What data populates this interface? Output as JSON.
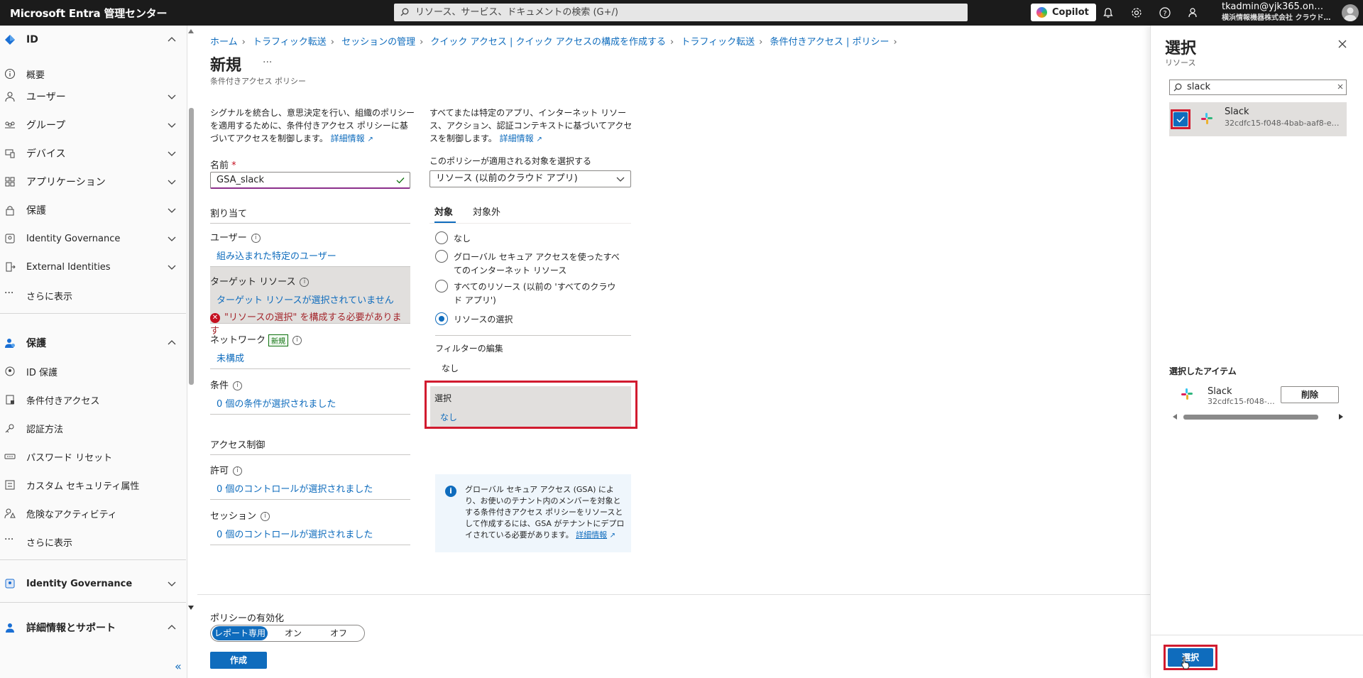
{
  "topbar": {
    "brand": "Microsoft Entra 管理センター",
    "search_placeholder": "リソース、サービス、ドキュメントの検索 (G+/)",
    "copilot": "Copilot",
    "user_email": "tkadmin@yjk365.on…",
    "user_org": "横浜情報機器株式会社 クラウド…"
  },
  "leftnav": {
    "items": [
      {
        "label": "ID"
      },
      {
        "label": "概要"
      },
      {
        "label": "ユーザー"
      },
      {
        "label": "グループ"
      },
      {
        "label": "デバイス"
      },
      {
        "label": "アプリケーション"
      },
      {
        "label": "保護"
      },
      {
        "label": "Identity Governance"
      },
      {
        "label": "External Identities"
      },
      {
        "label": "さらに表示"
      },
      {
        "label": "保護"
      },
      {
        "label": "ID 保護"
      },
      {
        "label": "条件付きアクセス"
      },
      {
        "label": "認証方法"
      },
      {
        "label": "パスワード リセット"
      },
      {
        "label": "カスタム セキュリティ属性"
      },
      {
        "label": "危険なアクティビティ"
      },
      {
        "label": "さらに表示"
      },
      {
        "label": "Identity Governance"
      },
      {
        "label": "詳細情報とサポート"
      }
    ],
    "collapse": "«"
  },
  "breadcrumb": [
    "ホーム",
    "トラフィック転送",
    "セッションの管理",
    "クイック アクセス | クイック アクセスの構成を作成する",
    "トラフィック転送",
    "条件付きアクセス | ポリシー"
  ],
  "page": {
    "title": "新規",
    "ellipsis": "···",
    "subtitle": "条件付きアクセス ポリシー"
  },
  "left_col": {
    "desc": "シグナルを統合し、意思決定を行い、組織のポリシーを適用するために、条件付きアクセス ポリシーに基づいてアクセスを制御します。",
    "desc_link": "詳細情報",
    "name_label": "名前",
    "name_required": "*",
    "name_value": "GSA_slack",
    "assignments": "割り当て",
    "users_label": "ユーザー",
    "users_value": "組み込まれた特定のユーザー",
    "target_label": "ターゲット リソース",
    "target_value": "ターゲット リソースが選択されていません",
    "target_error": "\"リソースの選択\" を構成する必要があります",
    "network_label": "ネットワーク",
    "network_badge": "新規",
    "network_value": "未構成",
    "conditions_label": "条件",
    "conditions_value": "0 個の条件が選択されました",
    "access_controls": "アクセス制御",
    "grant_label": "許可",
    "grant_value": "0 個のコントロールが選択されました",
    "session_label": "セッション",
    "session_value": "0 個のコントロールが選択されました"
  },
  "right_col": {
    "desc": "すべてまたは特定のアプリ、インターネット リソース、アクション、認証コンテキストに基づいてアクセスを制御します。",
    "desc_link": "詳細情報",
    "applies_label": "このポリシーが適用される対象を選択する",
    "applies_value": "リソース (以前のクラウド アプリ)",
    "tab_include": "対象",
    "tab_exclude": "対象外",
    "radio_none": "なし",
    "radio_gsa": "グローバル セキュア アクセスを使ったすべてのインターネット リソース",
    "radio_all": "すべてのリソース (以前の 'すべてのクラウド アプリ')",
    "radio_select": "リソースの選択",
    "filter_label": "フィルターの編集",
    "filter_value": "なし",
    "select_label": "選択",
    "select_value": "なし",
    "info_text": "グローバル セキュア アクセス (GSA) により、お使いのテナント内のメンバーを対象とする条件付きアクセス ポリシーをリソースとして作成するには、GSA がテナントにデプロイされている必要があります。",
    "info_link": "詳細情報"
  },
  "footer": {
    "enable_label": "ポリシーの有効化",
    "opt_report": "レポート専用",
    "opt_on": "オン",
    "opt_off": "オフ",
    "create": "作成"
  },
  "panel": {
    "title": "選択",
    "subtitle": "リソース",
    "search_value": "slack",
    "result_name": "Slack",
    "result_id": "32cdfc15-f048-4bab-aaf8-e…",
    "selected_title": "選択したアイテム",
    "selected_name": "Slack",
    "selected_id": "32cdfc15-f048-…",
    "remove": "削除",
    "select_button": "選択"
  },
  "colors": {
    "accent": "#0f6cbd",
    "error": "#c50f1f",
    "highlight_outline": "#d11b2f"
  }
}
